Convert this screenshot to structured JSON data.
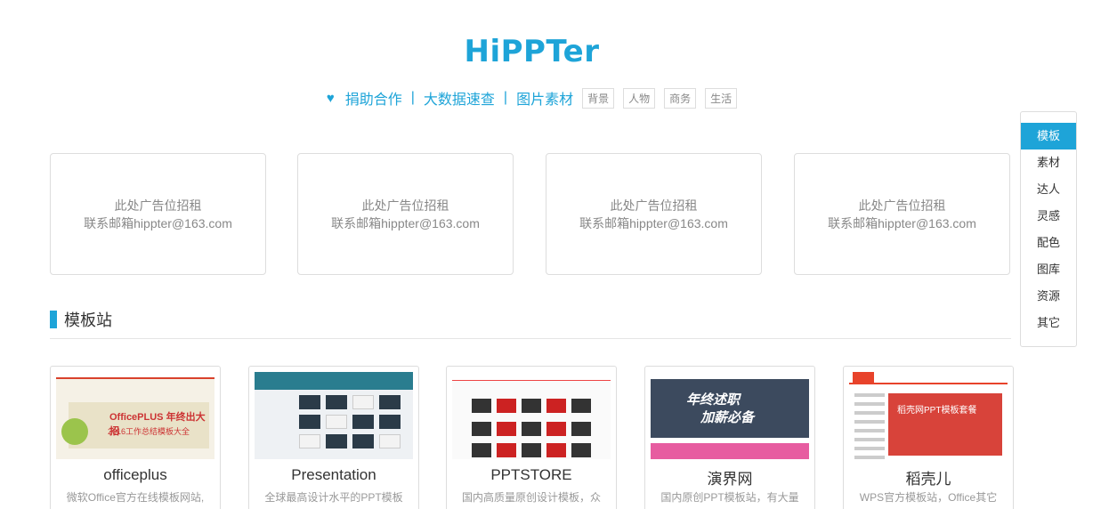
{
  "header": {
    "logo": "HiPPTer",
    "nav": {
      "heart": "♥",
      "link1": "捐助合作",
      "sep": "|",
      "link2": "大数据速查",
      "link3": "图片素材",
      "tags": [
        "背景",
        "人物",
        "商务",
        "生活"
      ]
    }
  },
  "ads": [
    {
      "line1": "此处广告位招租",
      "line2": "联系邮箱hippter@163.com"
    },
    {
      "line1": "此处广告位招租",
      "line2": "联系邮箱hippter@163.com"
    },
    {
      "line1": "此处广告位招租",
      "line2": "联系邮箱hippter@163.com"
    },
    {
      "line1": "此处广告位招租",
      "line2": "联系邮箱hippter@163.com"
    }
  ],
  "section": {
    "title": "模板站"
  },
  "cards": [
    {
      "title": "officeplus",
      "desc": "微软Office官方在线模板网站,",
      "thumb_text1": "OfficePLUS 年终出大招",
      "thumb_text2": "2016工作总结模板大全"
    },
    {
      "title": "Presentation",
      "desc": "全球最高设计水平的PPT模板"
    },
    {
      "title": "PPTSTORE",
      "desc": "国内高质量原创设计模板，众"
    },
    {
      "title": "演界网",
      "desc": "国内原创PPT模板站，有大量",
      "thumb_text1": "年终述职",
      "thumb_text2": "加薪必备"
    },
    {
      "title": "稻壳儿",
      "desc": "WPS官方模板站，Office其它",
      "thumb_text1": "稻壳网PPT模板套餐"
    }
  ],
  "sidebar": {
    "items": [
      "模板",
      "素材",
      "达人",
      "灵感",
      "配色",
      "图库",
      "资源",
      "其它"
    ],
    "active": "模板"
  },
  "colors": {
    "accent": "#1ea4d8",
    "border": "#dddddd",
    "muted": "#888888"
  }
}
